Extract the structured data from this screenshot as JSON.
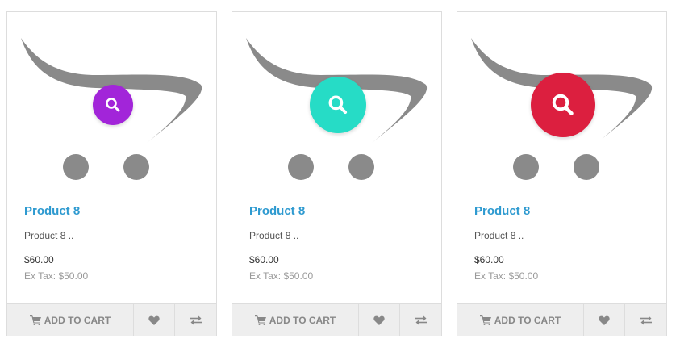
{
  "products": [
    {
      "name": "Product 8",
      "description": "Product 8 ..",
      "price": "$60.00",
      "tax": "Ex Tax: $50.00",
      "zoom_color": "#a225d9",
      "add_to_cart": "ADD TO CART",
      "wishlist_icon": "heart-icon",
      "compare_icon": "exchange-icon"
    },
    {
      "name": "Product 8",
      "description": "Product 8 ..",
      "price": "$60.00",
      "tax": "Ex Tax: $50.00",
      "zoom_color": "#26dcc6",
      "add_to_cart": "ADD TO CART",
      "wishlist_icon": "heart-icon",
      "compare_icon": "exchange-icon"
    },
    {
      "name": "Product 8",
      "description": "Product 8 ..",
      "price": "$60.00",
      "tax": "Ex Tax: $50.00",
      "zoom_color": "#dc1f3f",
      "add_to_cart": "ADD TO CART",
      "wishlist_icon": "heart-icon",
      "compare_icon": "exchange-icon"
    }
  ],
  "colors": {
    "link": "#2e9ad0",
    "button_bg": "#eeeeee",
    "cart_gray": "#8a8a8a"
  }
}
